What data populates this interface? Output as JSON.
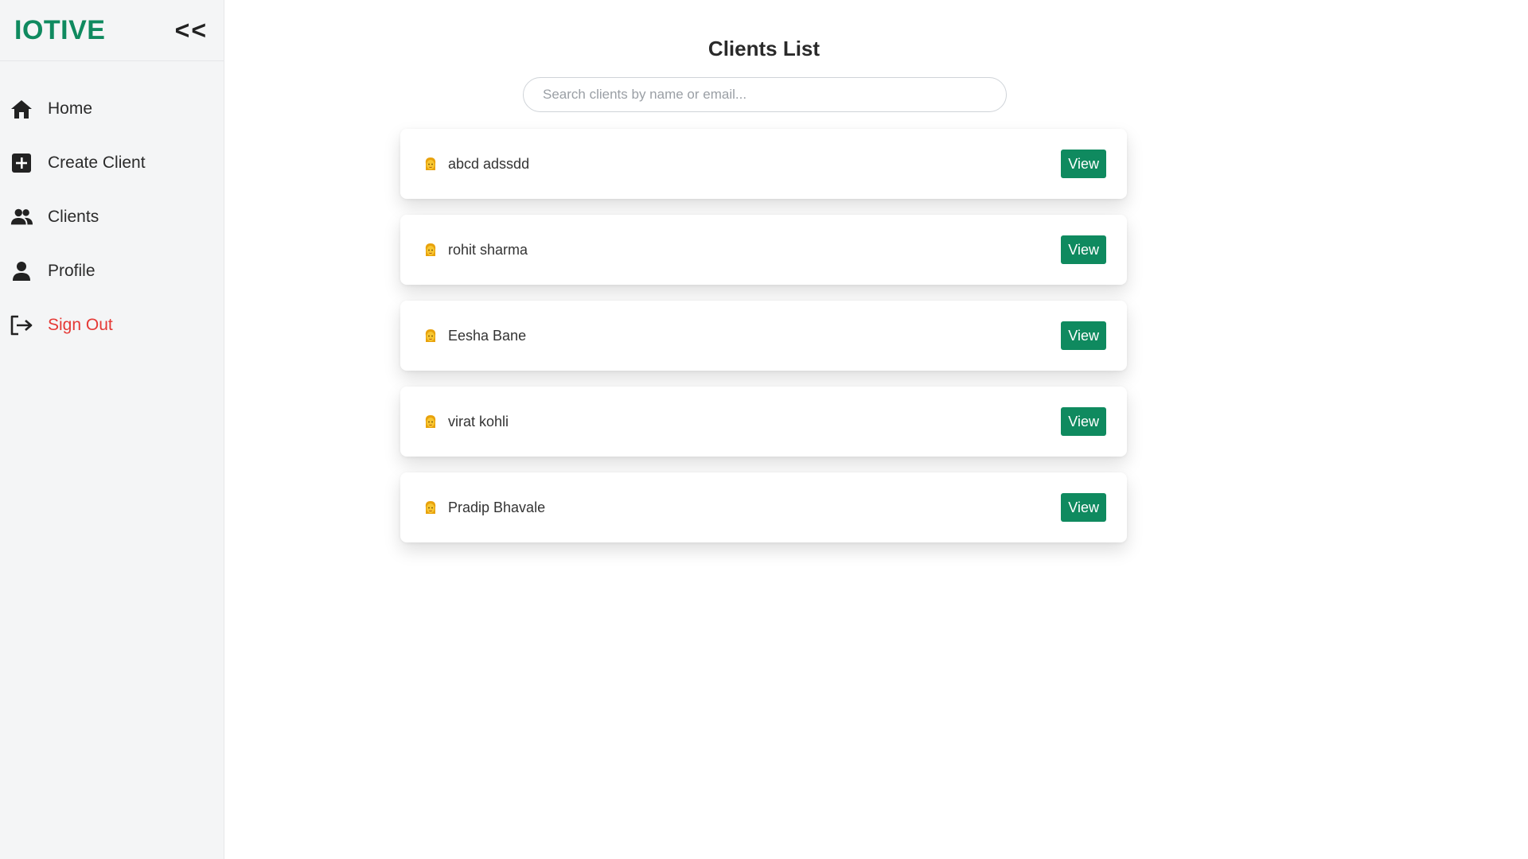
{
  "sidebar": {
    "brand": "IOTIVE",
    "collapse_label": "<<",
    "items": [
      {
        "label": "Home",
        "icon": "home-icon"
      },
      {
        "label": "Create Client",
        "icon": "plus-square-icon"
      },
      {
        "label": "Clients",
        "icon": "users-icon"
      },
      {
        "label": "Profile",
        "icon": "user-icon"
      },
      {
        "label": "Sign Out",
        "icon": "sign-out-icon",
        "color": "#e53935"
      }
    ]
  },
  "main": {
    "title": "Clients List",
    "search": {
      "placeholder": "Search clients by name or email...",
      "value": ""
    },
    "clients": [
      {
        "name": "abcd adssdd",
        "icon": "person-emoji-icon",
        "action_label": "View"
      },
      {
        "name": "rohit sharma",
        "icon": "person-emoji-icon",
        "action_label": "View"
      },
      {
        "name": "Eesha Bane",
        "icon": "person-emoji-icon",
        "action_label": "View"
      },
      {
        "name": "virat kohli",
        "icon": "person-emoji-icon",
        "action_label": "View"
      },
      {
        "name": "Pradip Bhavale",
        "icon": "person-emoji-icon",
        "action_label": "View"
      }
    ]
  },
  "colors": {
    "accent": "#0f8a5f",
    "sidebar_bg": "#f4f5f6",
    "danger": "#e53935"
  }
}
